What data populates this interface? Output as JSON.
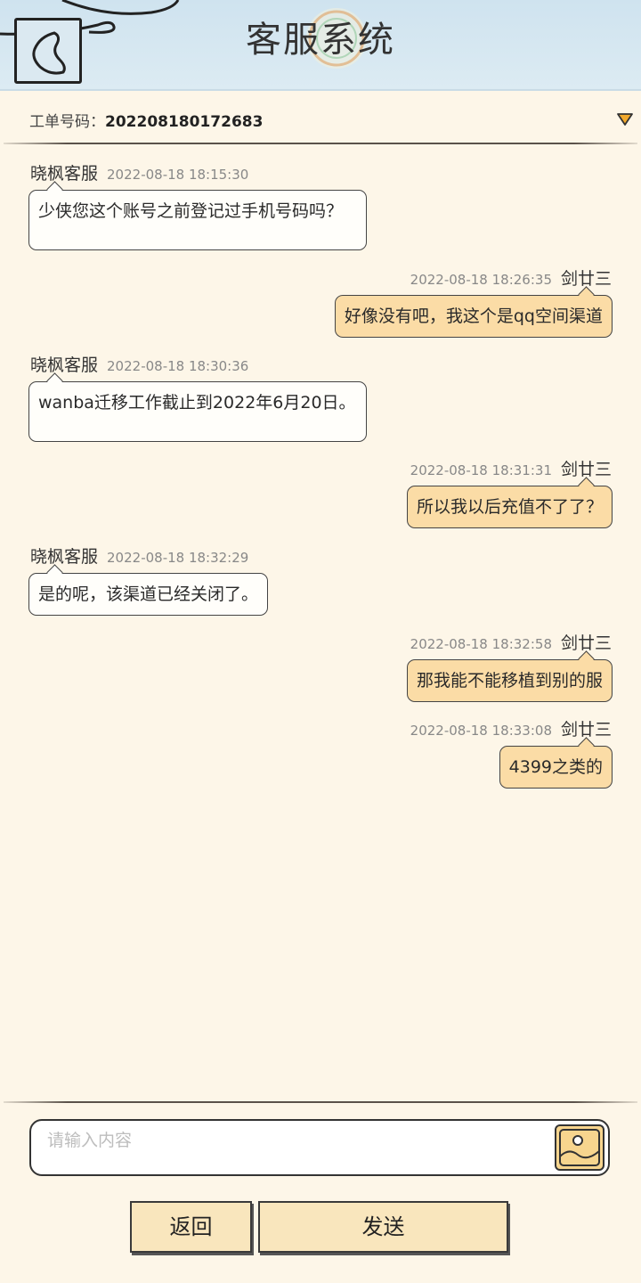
{
  "header": {
    "title": "客服系统",
    "back_icon": "chevron-left-icon"
  },
  "ticket": {
    "label": "工单号码：",
    "number": "202208180172683",
    "dropdown_icon": "triangle-down-icon"
  },
  "messages": [
    {
      "side": "left",
      "sender": "晓枫客服",
      "time": "2022-08-18 18:15:30",
      "text": "少侠您这个账号之前登记过手机号码吗？"
    },
    {
      "side": "right",
      "sender": "剑廿三",
      "time": "2022-08-18 18:26:35",
      "text": "好像没有吧，我这个是qq空间渠道"
    },
    {
      "side": "left",
      "sender": "晓枫客服",
      "time": "2022-08-18 18:30:36",
      "text": "wanba迁移工作截止到2022年6月20日。"
    },
    {
      "side": "right",
      "sender": "剑廿三",
      "time": "2022-08-18 18:31:31",
      "text": "所以我以后充值不了了？"
    },
    {
      "side": "left",
      "sender": "晓枫客服",
      "time": "2022-08-18 18:32:29",
      "text": "是的呢，该渠道已经关闭了。"
    },
    {
      "side": "right",
      "sender": "剑廿三",
      "time": "2022-08-18 18:32:58",
      "text": "那我能不能移植到别的服"
    },
    {
      "side": "right",
      "sender": "剑廿三",
      "time": "2022-08-18 18:33:08",
      "text": "4399之类的"
    }
  ],
  "input": {
    "placeholder": "请输入内容",
    "value": "",
    "image_icon": "image-icon"
  },
  "buttons": {
    "back_label": "返回",
    "send_label": "发送"
  },
  "colors": {
    "background": "#fdf6e8",
    "header": "#d6e8f2",
    "user_bubble": "#fbdca6",
    "agent_bubble": "#fffefa",
    "button": "#f9e6bd"
  }
}
